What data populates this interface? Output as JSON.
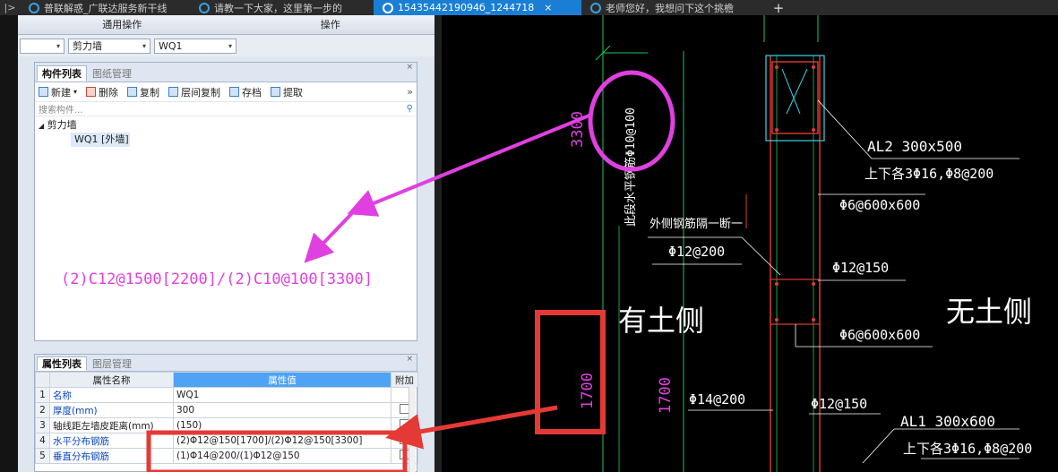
{
  "browser": {
    "tabs": [
      {
        "label": "普联解惑_广联达服务新干线",
        "active": false
      },
      {
        "label": "请教一下大家，这里第一步的",
        "active": false
      },
      {
        "label": "1543544219094б_1244718",
        "active": true
      },
      {
        "label": "老师您好，我想问下这个挑檐",
        "active": false
      }
    ],
    "new_tab": "+",
    "back": "|>"
  },
  "app": {
    "menu_groups": [
      "通用操作",
      "操作"
    ],
    "combos": [
      {
        "value": ""
      },
      {
        "value": "剪力墙"
      },
      {
        "value": "WQ1"
      }
    ],
    "component_panel": {
      "tabs": [
        "构件列表",
        "图纸管理"
      ],
      "toolbar": [
        "新建",
        "删除",
        "复制",
        "层间复制",
        "存档",
        "提取"
      ],
      "more": "»",
      "search_placeholder": "搜索构件...",
      "tree_group": "剪力墙",
      "tree_item": "WQ1 [外墙]"
    },
    "property_panel": {
      "tabs": [
        "属性列表",
        "图层管理"
      ],
      "headers": {
        "name": "属性名称",
        "value": "属性值",
        "extra": "附加"
      },
      "rows": [
        {
          "num": "1",
          "name": "名称",
          "value": "WQ1",
          "check": false
        },
        {
          "num": "2",
          "name": "厚度(mm)",
          "value": "300",
          "check": true
        },
        {
          "num": "3",
          "name": "轴线距左墙皮距离(mm)",
          "value": "(150)",
          "check": true
        },
        {
          "num": "4",
          "name": "水平分布钢筋",
          "value": "(2)Φ12@150[1700]/(2)Φ12@150[3300]",
          "check": true
        },
        {
          "num": "5",
          "name": "垂直分布钢筋",
          "value": "(1)Φ14@200/(1)Φ12@150",
          "check": true
        }
      ]
    }
  },
  "annotation": {
    "magenta_text": "(2)C12@1500[2200]/(2)C10@100[3300]"
  },
  "cad": {
    "labels": {
      "al2": "AL2 300x500",
      "al2_rebar": "上下各3Φ16,Φ8@200",
      "phi6_top": "Φ6@600x600",
      "outer": "外侧钢筋隔一断一",
      "phi12_200": "Φ12@200",
      "phi12_150_a": "Φ12@150",
      "soil": "有土侧",
      "nosoil": "无土侧",
      "phi6_bot": "Φ6@600x600",
      "phi14": "Φ14@200",
      "phi12_150_b": "Φ12@150",
      "al1": "AL1 300x600",
      "al1_rebar": "上下各3Φ16,Φ8@200",
      "dim3300": "3300",
      "dim1700a": "1700",
      "dim1700b": "1700",
      "vert_note": "此段水平钢筋Φ10@100"
    }
  },
  "colors": {
    "magenta": "#e040e0",
    "red_box": "#e53935",
    "active_tab": "#1a7fd4",
    "value_header": "#4fa3f5",
    "cad_green": "#22c55e",
    "cad_red": "#e53935",
    "cad_cyan": "#38d6e8"
  }
}
